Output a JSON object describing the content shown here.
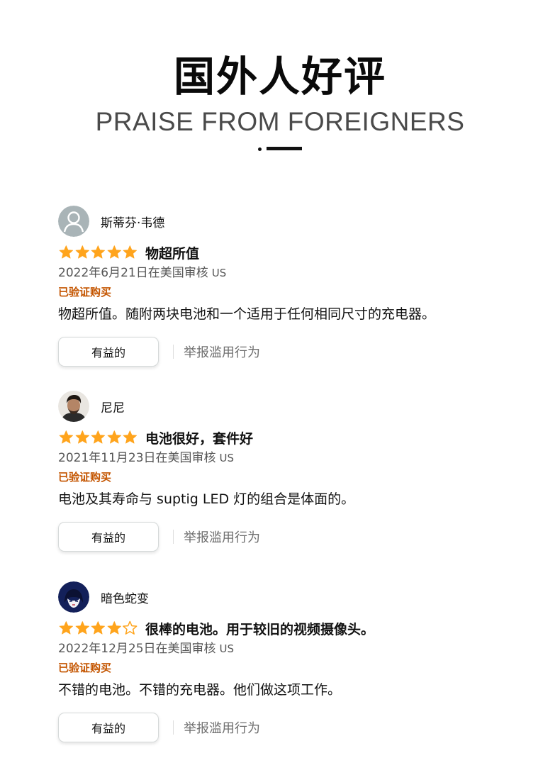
{
  "header": {
    "title_cn": "国外人好评",
    "title_en": "PRAISE FROM FOREIGNERS"
  },
  "colors": {
    "star": "#ffa41c",
    "verified": "#c45500",
    "text": "#111111",
    "muted": "#555555"
  },
  "reviews": [
    {
      "username": "斯蒂芬·韦德",
      "avatar": "default-user-avatar",
      "rating": 5,
      "title": "物超所值",
      "date": "2022年6月21日在美国审核",
      "region": "US",
      "verified": "已验证购买",
      "body": "物超所值。随附两块电池和一个适用于任何相同尺寸的充电器。",
      "helpful_label": "有益的",
      "report_label": "举报滥用行为"
    },
    {
      "username": "尼尼",
      "avatar": "photo-avatar",
      "rating": 5,
      "title": "电池很好，套件好",
      "date": "2021年11月23日在美国审核",
      "region": "US",
      "verified": "已验证购买",
      "body": "电池及其寿命与 suptig LED 灯的组合是体面的。",
      "helpful_label": "有益的",
      "report_label": "举报滥用行为"
    },
    {
      "username": "暗色蛇变",
      "avatar": "illustrated-avatar",
      "rating": 4,
      "title": "很棒的电池。用于较旧的视频摄像头。",
      "date": "2022年12月25日在美国审核",
      "region": "US",
      "verified": "已验证购买",
      "body": "不错的电池。不错的充电器。他们做这项工作。",
      "helpful_label": "有益的",
      "report_label": "举报滥用行为"
    }
  ]
}
